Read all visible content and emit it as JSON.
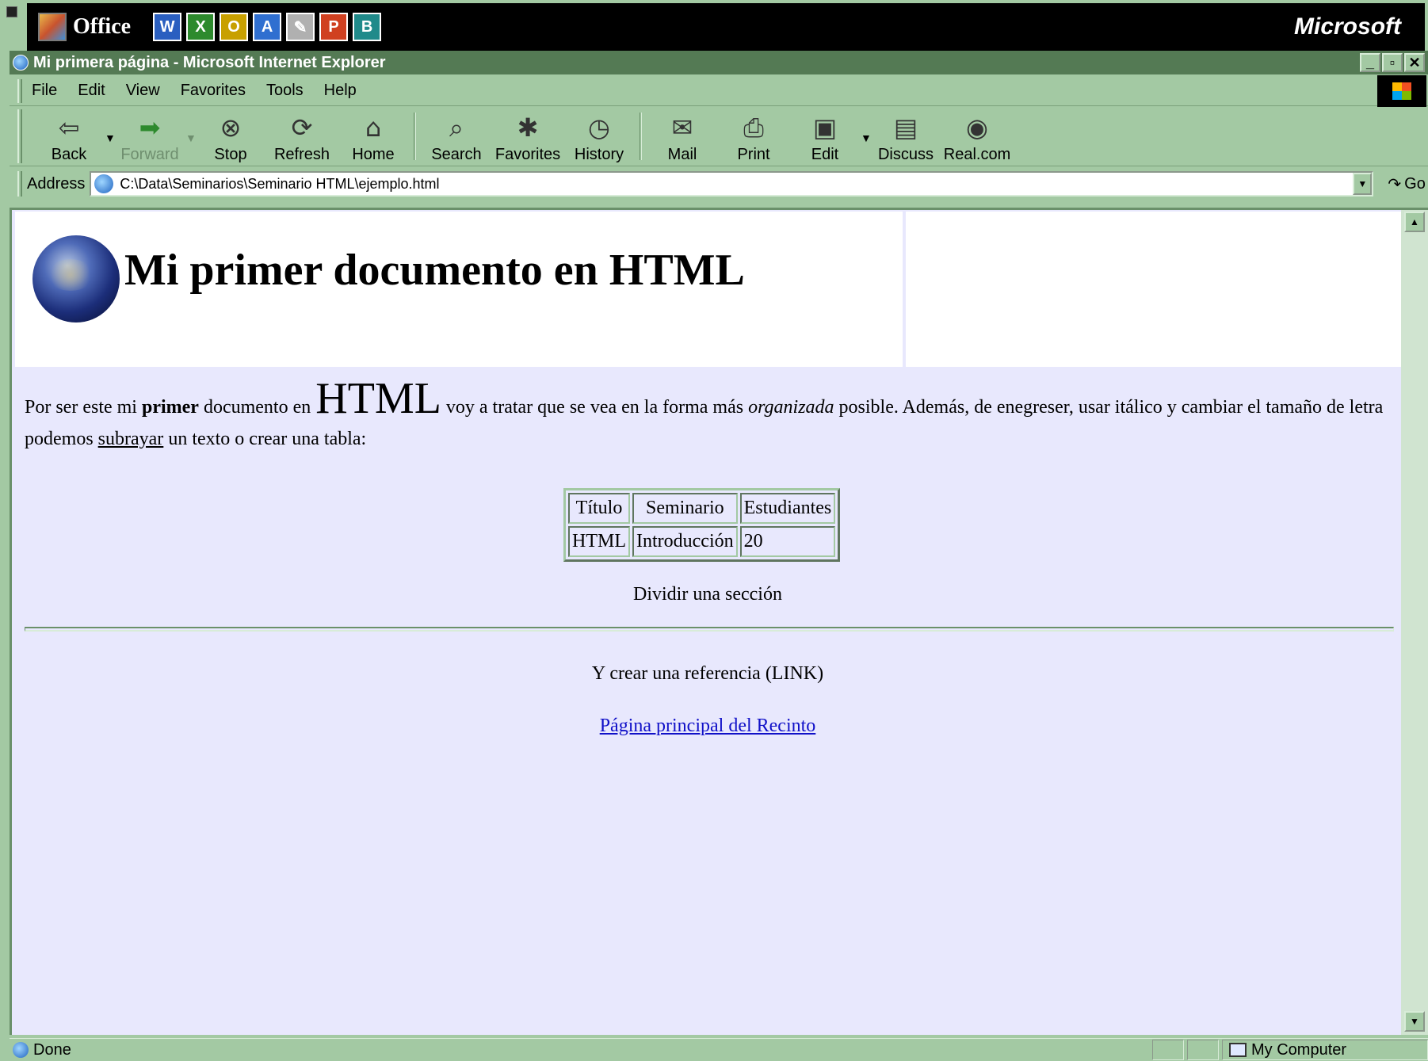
{
  "office_bar": {
    "title": "Office",
    "apps": [
      {
        "name": "word-icon",
        "glyph": "W",
        "color": "#2a5fc0"
      },
      {
        "name": "excel-icon",
        "glyph": "X",
        "color": "#2d8a2d"
      },
      {
        "name": "outlook-icon",
        "glyph": "O",
        "color": "#c8a000"
      },
      {
        "name": "access-icon",
        "glyph": "A",
        "color": "#2f6fd0"
      },
      {
        "name": "notes-icon",
        "glyph": "✎",
        "color": "#b0b0b0"
      },
      {
        "name": "powerpoint-icon",
        "glyph": "P",
        "color": "#d04020"
      },
      {
        "name": "publisher-icon",
        "glyph": "B",
        "color": "#208a8a"
      }
    ],
    "brand": "Microsoft"
  },
  "window": {
    "title": "Mi primera página - Microsoft Internet Explorer",
    "controls": {
      "minimize": "_",
      "restore": "▫",
      "close": "✕"
    }
  },
  "menu": {
    "items": [
      "File",
      "Edit",
      "View",
      "Favorites",
      "Tools",
      "Help"
    ]
  },
  "toolbar": {
    "back": "Back",
    "forward": "Forward",
    "stop": "Stop",
    "refresh": "Refresh",
    "home": "Home",
    "search": "Search",
    "favorites": "Favorites",
    "history": "History",
    "mail": "Mail",
    "print": "Print",
    "edit": "Edit",
    "discuss": "Discuss",
    "realcom": "Real.com"
  },
  "address": {
    "label": "Address",
    "url": "C:\\Data\\Seminarios\\Seminario HTML\\ejemplo.html",
    "go": "Go"
  },
  "page": {
    "heading": "Mi primer documento en HTML",
    "para": {
      "t1": "Por ser este mi ",
      "bold": "primer",
      "t2": " documento en ",
      "big": "HTML",
      "t3": " voy a tratar que se vea en la forma más ",
      "italic": "organizada",
      "t4": " posible. Además, de enegreser, usar itálico y cambiar el tamaño de letra podemos ",
      "underline": "subrayar",
      "t5": " un texto o crear una tabla:"
    },
    "table": {
      "headers": [
        "Título",
        "Seminario",
        "Estudiantes"
      ],
      "rows": [
        [
          "HTML",
          "Introducción",
          "20"
        ]
      ]
    },
    "section_label": "Dividir una sección",
    "ref_text": "Y crear una referencia (LINK)",
    "link_text": "Página principal del Recinto"
  },
  "status": {
    "text": "Done",
    "zone": "My Computer"
  }
}
